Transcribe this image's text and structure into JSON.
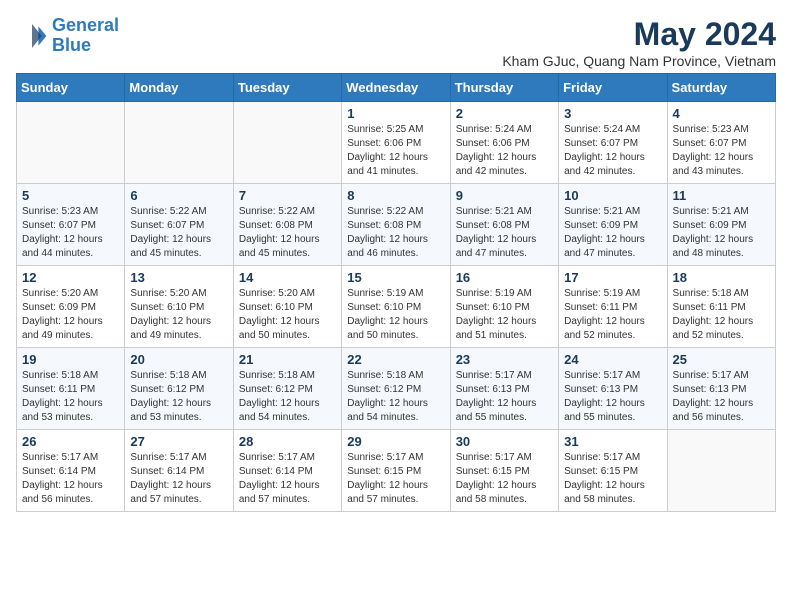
{
  "logo": {
    "line1": "General",
    "line2": "Blue"
  },
  "header": {
    "month_year": "May 2024",
    "location": "Kham GJuc, Quang Nam Province, Vietnam"
  },
  "weekdays": [
    "Sunday",
    "Monday",
    "Tuesday",
    "Wednesday",
    "Thursday",
    "Friday",
    "Saturday"
  ],
  "weeks": [
    [
      {
        "day": "",
        "info": ""
      },
      {
        "day": "",
        "info": ""
      },
      {
        "day": "",
        "info": ""
      },
      {
        "day": "1",
        "info": "Sunrise: 5:25 AM\nSunset: 6:06 PM\nDaylight: 12 hours\nand 41 minutes."
      },
      {
        "day": "2",
        "info": "Sunrise: 5:24 AM\nSunset: 6:06 PM\nDaylight: 12 hours\nand 42 minutes."
      },
      {
        "day": "3",
        "info": "Sunrise: 5:24 AM\nSunset: 6:07 PM\nDaylight: 12 hours\nand 42 minutes."
      },
      {
        "day": "4",
        "info": "Sunrise: 5:23 AM\nSunset: 6:07 PM\nDaylight: 12 hours\nand 43 minutes."
      }
    ],
    [
      {
        "day": "5",
        "info": "Sunrise: 5:23 AM\nSunset: 6:07 PM\nDaylight: 12 hours\nand 44 minutes."
      },
      {
        "day": "6",
        "info": "Sunrise: 5:22 AM\nSunset: 6:07 PM\nDaylight: 12 hours\nand 45 minutes."
      },
      {
        "day": "7",
        "info": "Sunrise: 5:22 AM\nSunset: 6:08 PM\nDaylight: 12 hours\nand 45 minutes."
      },
      {
        "day": "8",
        "info": "Sunrise: 5:22 AM\nSunset: 6:08 PM\nDaylight: 12 hours\nand 46 minutes."
      },
      {
        "day": "9",
        "info": "Sunrise: 5:21 AM\nSunset: 6:08 PM\nDaylight: 12 hours\nand 47 minutes."
      },
      {
        "day": "10",
        "info": "Sunrise: 5:21 AM\nSunset: 6:09 PM\nDaylight: 12 hours\nand 47 minutes."
      },
      {
        "day": "11",
        "info": "Sunrise: 5:21 AM\nSunset: 6:09 PM\nDaylight: 12 hours\nand 48 minutes."
      }
    ],
    [
      {
        "day": "12",
        "info": "Sunrise: 5:20 AM\nSunset: 6:09 PM\nDaylight: 12 hours\nand 49 minutes."
      },
      {
        "day": "13",
        "info": "Sunrise: 5:20 AM\nSunset: 6:10 PM\nDaylight: 12 hours\nand 49 minutes."
      },
      {
        "day": "14",
        "info": "Sunrise: 5:20 AM\nSunset: 6:10 PM\nDaylight: 12 hours\nand 50 minutes."
      },
      {
        "day": "15",
        "info": "Sunrise: 5:19 AM\nSunset: 6:10 PM\nDaylight: 12 hours\nand 50 minutes."
      },
      {
        "day": "16",
        "info": "Sunrise: 5:19 AM\nSunset: 6:10 PM\nDaylight: 12 hours\nand 51 minutes."
      },
      {
        "day": "17",
        "info": "Sunrise: 5:19 AM\nSunset: 6:11 PM\nDaylight: 12 hours\nand 52 minutes."
      },
      {
        "day": "18",
        "info": "Sunrise: 5:18 AM\nSunset: 6:11 PM\nDaylight: 12 hours\nand 52 minutes."
      }
    ],
    [
      {
        "day": "19",
        "info": "Sunrise: 5:18 AM\nSunset: 6:11 PM\nDaylight: 12 hours\nand 53 minutes."
      },
      {
        "day": "20",
        "info": "Sunrise: 5:18 AM\nSunset: 6:12 PM\nDaylight: 12 hours\nand 53 minutes."
      },
      {
        "day": "21",
        "info": "Sunrise: 5:18 AM\nSunset: 6:12 PM\nDaylight: 12 hours\nand 54 minutes."
      },
      {
        "day": "22",
        "info": "Sunrise: 5:18 AM\nSunset: 6:12 PM\nDaylight: 12 hours\nand 54 minutes."
      },
      {
        "day": "23",
        "info": "Sunrise: 5:17 AM\nSunset: 6:13 PM\nDaylight: 12 hours\nand 55 minutes."
      },
      {
        "day": "24",
        "info": "Sunrise: 5:17 AM\nSunset: 6:13 PM\nDaylight: 12 hours\nand 55 minutes."
      },
      {
        "day": "25",
        "info": "Sunrise: 5:17 AM\nSunset: 6:13 PM\nDaylight: 12 hours\nand 56 minutes."
      }
    ],
    [
      {
        "day": "26",
        "info": "Sunrise: 5:17 AM\nSunset: 6:14 PM\nDaylight: 12 hours\nand 56 minutes."
      },
      {
        "day": "27",
        "info": "Sunrise: 5:17 AM\nSunset: 6:14 PM\nDaylight: 12 hours\nand 57 minutes."
      },
      {
        "day": "28",
        "info": "Sunrise: 5:17 AM\nSunset: 6:14 PM\nDaylight: 12 hours\nand 57 minutes."
      },
      {
        "day": "29",
        "info": "Sunrise: 5:17 AM\nSunset: 6:15 PM\nDaylight: 12 hours\nand 57 minutes."
      },
      {
        "day": "30",
        "info": "Sunrise: 5:17 AM\nSunset: 6:15 PM\nDaylight: 12 hours\nand 58 minutes."
      },
      {
        "day": "31",
        "info": "Sunrise: 5:17 AM\nSunset: 6:15 PM\nDaylight: 12 hours\nand 58 minutes."
      },
      {
        "day": "",
        "info": ""
      }
    ]
  ]
}
